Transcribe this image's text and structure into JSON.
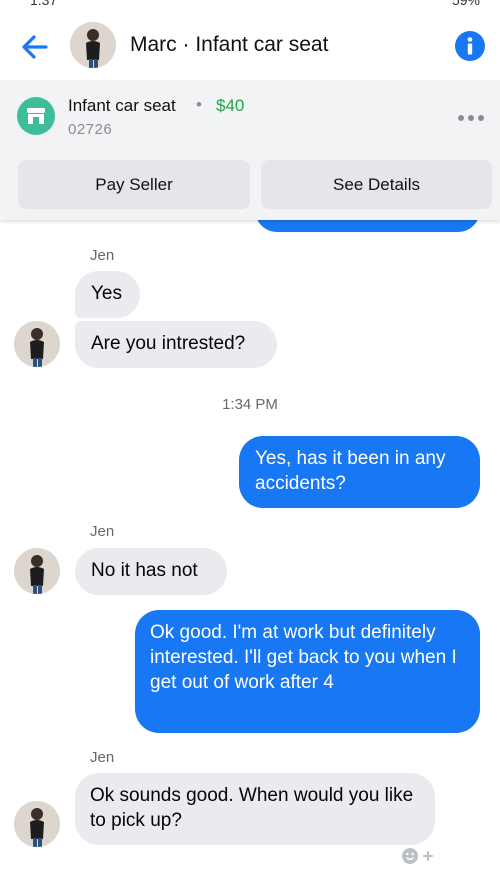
{
  "status_bar": {
    "time": "1:37",
    "battery": "59%"
  },
  "header": {
    "back_icon": "arrow-left-icon",
    "title": "Marc · Infant car seat",
    "info_icon": "info-icon",
    "accent": "#1877f2"
  },
  "listing": {
    "icon": "storefront-icon",
    "title": "Infant car seat",
    "separator": "•",
    "price": "$40",
    "zip": "02726",
    "more_icon": "more-horizontal-icon",
    "pay_button": "Pay Seller",
    "details_button": "See Details"
  },
  "messages": [
    {
      "sender": "Jen"
    },
    {
      "text": "Yes"
    },
    {
      "text": "Are you intrested?"
    },
    {
      "timestamp": "1:34 PM"
    },
    {
      "text": "Yes, has it been in any accidents?"
    },
    {
      "sender": "Jen"
    },
    {
      "text": "No it has not"
    },
    {
      "text": "Ok good. I'm at work but definitely interested. I'll get back to you when I get out of work after 4"
    },
    {
      "sender": "Jen"
    },
    {
      "text": "Ok sounds good.  When would you like to pick up?"
    }
  ],
  "colors": {
    "outgoing_bubble": "#1877f2",
    "incoming_bubble": "#eaebee",
    "price": "#24a148",
    "listing_icon": "#3ebd9a"
  }
}
